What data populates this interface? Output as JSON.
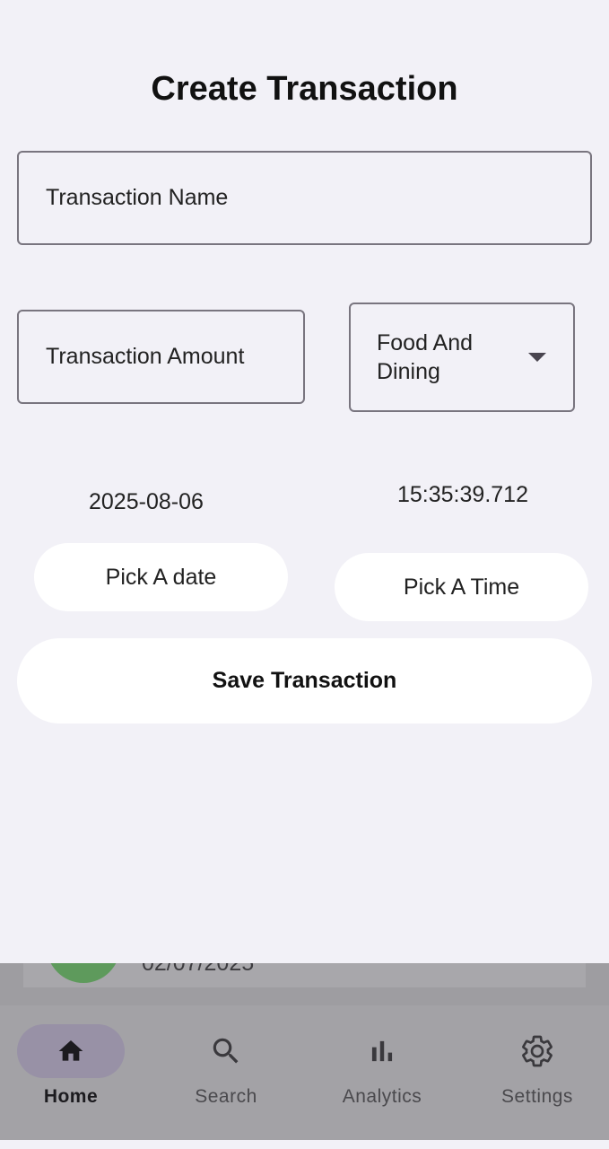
{
  "page": {
    "title": "Create Transaction"
  },
  "form": {
    "name_placeholder": "Transaction Name",
    "amount_placeholder": "Transaction Amount",
    "category_selected": "Food And\nDining",
    "date_value": "2025-08-06",
    "time_value": "15:35:39.712",
    "pick_date_label": "Pick A date",
    "pick_time_label": "Pick A Time",
    "save_label": "Save Transaction"
  },
  "underlay": {
    "partial_date_text": "02/07/2025"
  },
  "nav": {
    "items": [
      {
        "label": "Home",
        "icon": "home-icon",
        "active": true
      },
      {
        "label": "Search",
        "icon": "search-icon",
        "active": false
      },
      {
        "label": "Analytics",
        "icon": "bar-chart-icon",
        "active": false
      },
      {
        "label": "Settings",
        "icon": "gear-icon",
        "active": false
      }
    ]
  },
  "colors": {
    "background": "#f2f1f7",
    "nav_background": "#a3a2a6",
    "active_indicator": "#9891a6",
    "avatar_green": "#5e9a5c"
  }
}
